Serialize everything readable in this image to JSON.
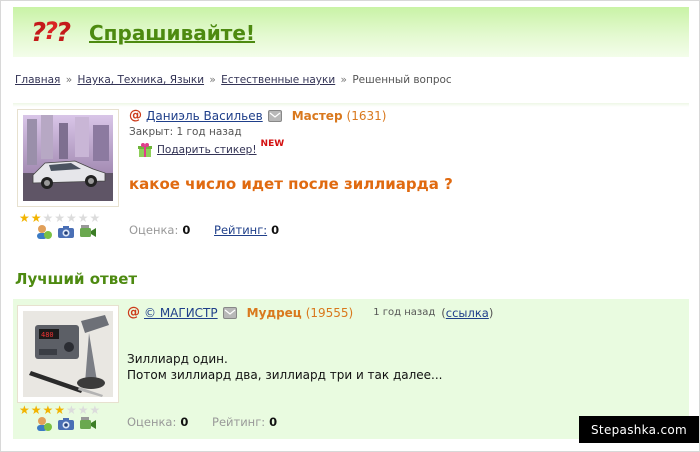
{
  "header": {
    "title": "Спрашивайте!",
    "logo_icon": "question-marks-logo",
    "accent_color": "#4d8a10"
  },
  "breadcrumb": {
    "items": [
      "Главная",
      "Наука, Техника, Языки",
      "Естественные науки",
      "Решенный вопрос"
    ],
    "separator": "»"
  },
  "question": {
    "author": "Даниэль Васильев",
    "rank": "Мастер",
    "rank_score": "(1631)",
    "closed": "Закрыт: 1 год назад",
    "gift_label": "Подарить стикер!",
    "new_badge": "NEW",
    "text": "какое число идет после зиллиарда ?",
    "score_label": "Оценка:",
    "score_value": "0",
    "rating_label": "Рейтинг:",
    "rating_value": "0",
    "stars_filled": 2,
    "stars_total": 7
  },
  "best_answer": {
    "title": "Лучший ответ",
    "author": "© МАГИСТР",
    "rank": "Мудрец",
    "rank_score": "(19555)",
    "time": "1 год назад",
    "link_open": "(",
    "link_label": "ссылка",
    "link_close": ")",
    "line1": "Зиллиард один.",
    "line2": "Потом зиллиард два, зиллиард три и так далее...",
    "score_label": "Оценка:",
    "score_value": "0",
    "rating_label": "Рейтинг:",
    "rating_value": "0",
    "stars_filled": 4,
    "stars_total": 7
  },
  "watermark": "Stepashka.com"
}
